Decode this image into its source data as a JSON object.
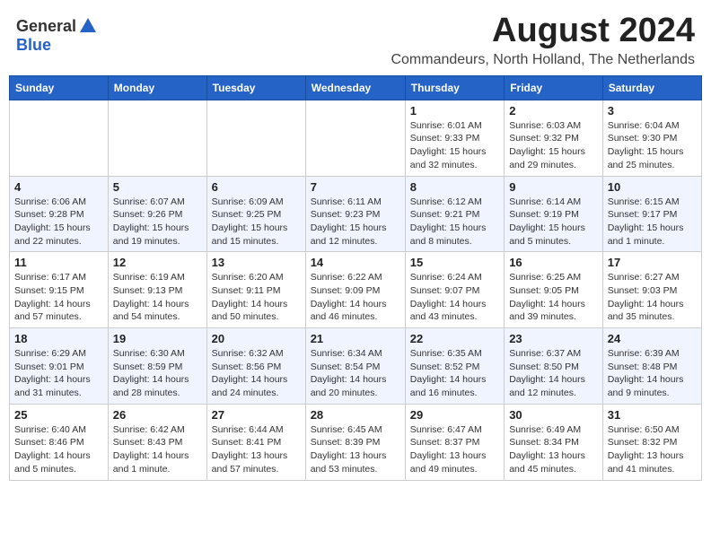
{
  "logo": {
    "general": "General",
    "blue": "Blue"
  },
  "title": "August 2024",
  "location": "Commandeurs, North Holland, The Netherlands",
  "headers": [
    "Sunday",
    "Monday",
    "Tuesday",
    "Wednesday",
    "Thursday",
    "Friday",
    "Saturday"
  ],
  "weeks": [
    [
      {
        "day": "",
        "sunrise": "",
        "sunset": "",
        "daylight": ""
      },
      {
        "day": "",
        "sunrise": "",
        "sunset": "",
        "daylight": ""
      },
      {
        "day": "",
        "sunrise": "",
        "sunset": "",
        "daylight": ""
      },
      {
        "day": "",
        "sunrise": "",
        "sunset": "",
        "daylight": ""
      },
      {
        "day": "1",
        "sunrise": "Sunrise: 6:01 AM",
        "sunset": "Sunset: 9:33 PM",
        "daylight": "Daylight: 15 hours and 32 minutes."
      },
      {
        "day": "2",
        "sunrise": "Sunrise: 6:03 AM",
        "sunset": "Sunset: 9:32 PM",
        "daylight": "Daylight: 15 hours and 29 minutes."
      },
      {
        "day": "3",
        "sunrise": "Sunrise: 6:04 AM",
        "sunset": "Sunset: 9:30 PM",
        "daylight": "Daylight: 15 hours and 25 minutes."
      }
    ],
    [
      {
        "day": "4",
        "sunrise": "Sunrise: 6:06 AM",
        "sunset": "Sunset: 9:28 PM",
        "daylight": "Daylight: 15 hours and 22 minutes."
      },
      {
        "day": "5",
        "sunrise": "Sunrise: 6:07 AM",
        "sunset": "Sunset: 9:26 PM",
        "daylight": "Daylight: 15 hours and 19 minutes."
      },
      {
        "day": "6",
        "sunrise": "Sunrise: 6:09 AM",
        "sunset": "Sunset: 9:25 PM",
        "daylight": "Daylight: 15 hours and 15 minutes."
      },
      {
        "day": "7",
        "sunrise": "Sunrise: 6:11 AM",
        "sunset": "Sunset: 9:23 PM",
        "daylight": "Daylight: 15 hours and 12 minutes."
      },
      {
        "day": "8",
        "sunrise": "Sunrise: 6:12 AM",
        "sunset": "Sunset: 9:21 PM",
        "daylight": "Daylight: 15 hours and 8 minutes."
      },
      {
        "day": "9",
        "sunrise": "Sunrise: 6:14 AM",
        "sunset": "Sunset: 9:19 PM",
        "daylight": "Daylight: 15 hours and 5 minutes."
      },
      {
        "day": "10",
        "sunrise": "Sunrise: 6:15 AM",
        "sunset": "Sunset: 9:17 PM",
        "daylight": "Daylight: 15 hours and 1 minute."
      }
    ],
    [
      {
        "day": "11",
        "sunrise": "Sunrise: 6:17 AM",
        "sunset": "Sunset: 9:15 PM",
        "daylight": "Daylight: 14 hours and 57 minutes."
      },
      {
        "day": "12",
        "sunrise": "Sunrise: 6:19 AM",
        "sunset": "Sunset: 9:13 PM",
        "daylight": "Daylight: 14 hours and 54 minutes."
      },
      {
        "day": "13",
        "sunrise": "Sunrise: 6:20 AM",
        "sunset": "Sunset: 9:11 PM",
        "daylight": "Daylight: 14 hours and 50 minutes."
      },
      {
        "day": "14",
        "sunrise": "Sunrise: 6:22 AM",
        "sunset": "Sunset: 9:09 PM",
        "daylight": "Daylight: 14 hours and 46 minutes."
      },
      {
        "day": "15",
        "sunrise": "Sunrise: 6:24 AM",
        "sunset": "Sunset: 9:07 PM",
        "daylight": "Daylight: 14 hours and 43 minutes."
      },
      {
        "day": "16",
        "sunrise": "Sunrise: 6:25 AM",
        "sunset": "Sunset: 9:05 PM",
        "daylight": "Daylight: 14 hours and 39 minutes."
      },
      {
        "day": "17",
        "sunrise": "Sunrise: 6:27 AM",
        "sunset": "Sunset: 9:03 PM",
        "daylight": "Daylight: 14 hours and 35 minutes."
      }
    ],
    [
      {
        "day": "18",
        "sunrise": "Sunrise: 6:29 AM",
        "sunset": "Sunset: 9:01 PM",
        "daylight": "Daylight: 14 hours and 31 minutes."
      },
      {
        "day": "19",
        "sunrise": "Sunrise: 6:30 AM",
        "sunset": "Sunset: 8:59 PM",
        "daylight": "Daylight: 14 hours and 28 minutes."
      },
      {
        "day": "20",
        "sunrise": "Sunrise: 6:32 AM",
        "sunset": "Sunset: 8:56 PM",
        "daylight": "Daylight: 14 hours and 24 minutes."
      },
      {
        "day": "21",
        "sunrise": "Sunrise: 6:34 AM",
        "sunset": "Sunset: 8:54 PM",
        "daylight": "Daylight: 14 hours and 20 minutes."
      },
      {
        "day": "22",
        "sunrise": "Sunrise: 6:35 AM",
        "sunset": "Sunset: 8:52 PM",
        "daylight": "Daylight: 14 hours and 16 minutes."
      },
      {
        "day": "23",
        "sunrise": "Sunrise: 6:37 AM",
        "sunset": "Sunset: 8:50 PM",
        "daylight": "Daylight: 14 hours and 12 minutes."
      },
      {
        "day": "24",
        "sunrise": "Sunrise: 6:39 AM",
        "sunset": "Sunset: 8:48 PM",
        "daylight": "Daylight: 14 hours and 9 minutes."
      }
    ],
    [
      {
        "day": "25",
        "sunrise": "Sunrise: 6:40 AM",
        "sunset": "Sunset: 8:46 PM",
        "daylight": "Daylight: 14 hours and 5 minutes."
      },
      {
        "day": "26",
        "sunrise": "Sunrise: 6:42 AM",
        "sunset": "Sunset: 8:43 PM",
        "daylight": "Daylight: 14 hours and 1 minute."
      },
      {
        "day": "27",
        "sunrise": "Sunrise: 6:44 AM",
        "sunset": "Sunset: 8:41 PM",
        "daylight": "Daylight: 13 hours and 57 minutes."
      },
      {
        "day": "28",
        "sunrise": "Sunrise: 6:45 AM",
        "sunset": "Sunset: 8:39 PM",
        "daylight": "Daylight: 13 hours and 53 minutes."
      },
      {
        "day": "29",
        "sunrise": "Sunrise: 6:47 AM",
        "sunset": "Sunset: 8:37 PM",
        "daylight": "Daylight: 13 hours and 49 minutes."
      },
      {
        "day": "30",
        "sunrise": "Sunrise: 6:49 AM",
        "sunset": "Sunset: 8:34 PM",
        "daylight": "Daylight: 13 hours and 45 minutes."
      },
      {
        "day": "31",
        "sunrise": "Sunrise: 6:50 AM",
        "sunset": "Sunset: 8:32 PM",
        "daylight": "Daylight: 13 hours and 41 minutes."
      }
    ]
  ]
}
